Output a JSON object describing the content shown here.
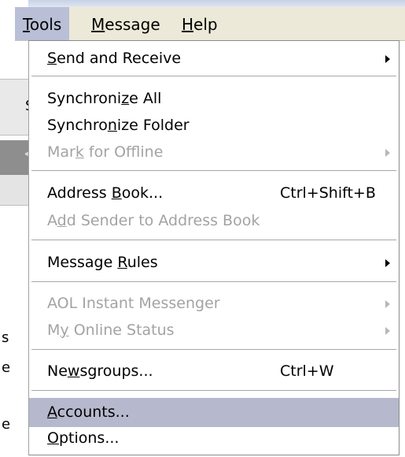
{
  "menubar": {
    "items": [
      {
        "label": "Tools",
        "mnemonic": "T",
        "rest": "ools",
        "active": true
      },
      {
        "label": "Message",
        "mnemonic": "M",
        "rest": "essage"
      },
      {
        "label": "Help",
        "mnemonic": "H",
        "rest": "elp"
      }
    ]
  },
  "background": {
    "frag1": "Se",
    "frag2": "<",
    "frag3": "s",
    "frag4": "e",
    "frag5": "e"
  },
  "menu": {
    "send_receive": {
      "pre": "",
      "u": "S",
      "post": "end and Receive"
    },
    "sync_all": {
      "pre": "Synchroni",
      "u": "z",
      "post": "e All"
    },
    "sync_folder": {
      "pre": "Synchro",
      "u": "n",
      "post": "ize Folder"
    },
    "mark_offline": {
      "pre": "Mar",
      "u": "k",
      "post": " for Offline"
    },
    "address_book": {
      "pre": "Address ",
      "u": "B",
      "post": "ook...",
      "shortcut": "Ctrl+Shift+B"
    },
    "add_sender": {
      "pre": "A",
      "u": "d",
      "post": "d Sender to Address Book"
    },
    "message_rules": {
      "pre": "Message ",
      "u": "R",
      "post": "ules"
    },
    "aol_im": {
      "pre": "AOL Instant Messenger",
      "u": "",
      "post": ""
    },
    "online_status": {
      "pre": "M",
      "u": "y",
      "post": " Online Status"
    },
    "newsgroups": {
      "pre": "Ne",
      "u": "w",
      "post": "sgroups...",
      "shortcut": "Ctrl+W"
    },
    "accounts": {
      "pre": "",
      "u": "A",
      "post": "ccounts..."
    },
    "options": {
      "pre": "",
      "u": "O",
      "post": "ptions..."
    }
  }
}
